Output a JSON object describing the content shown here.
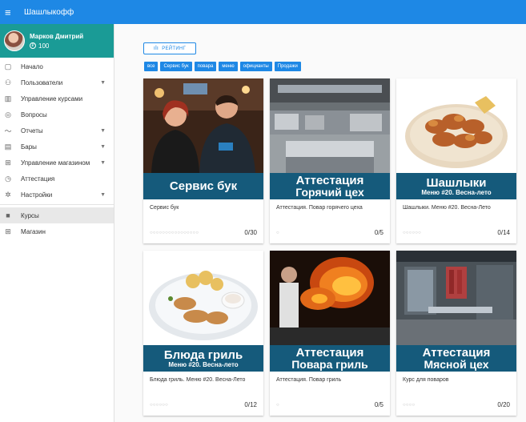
{
  "app": {
    "title": "Шашлыкофф"
  },
  "profile": {
    "name": "Марков Дмитрий",
    "points": "100"
  },
  "nav": {
    "items": [
      {
        "label": "Начало",
        "icon": "clipboard-icon",
        "glyph": "▢",
        "arrow": false
      },
      {
        "label": "Пользователи",
        "icon": "users-icon",
        "glyph": "⚇",
        "arrow": true
      },
      {
        "label": "Управление курсами",
        "icon": "library-icon",
        "glyph": "▥",
        "arrow": false
      },
      {
        "label": "Вопросы",
        "icon": "help-circle-icon",
        "glyph": "◎",
        "arrow": false
      },
      {
        "label": "Отчеты",
        "icon": "trending-icon",
        "glyph": "〜",
        "arrow": true
      },
      {
        "label": "Бары",
        "icon": "store-icon",
        "glyph": "▤",
        "arrow": true
      },
      {
        "label": "Управление магазином",
        "icon": "cart-icon",
        "glyph": "⊞",
        "arrow": true
      },
      {
        "label": "Аттестация",
        "icon": "alarm-icon",
        "glyph": "◷",
        "arrow": false
      },
      {
        "label": "Настройки",
        "icon": "gear-icon",
        "glyph": "✲",
        "arrow": true
      }
    ],
    "secondary": [
      {
        "label": "Курсы",
        "icon": "folder-icon",
        "glyph": "■",
        "active": true
      },
      {
        "label": "Магазин",
        "icon": "cart-icon",
        "glyph": "⊞",
        "active": false
      }
    ]
  },
  "main": {
    "rating_label": "РЕЙТИНГ",
    "tags": [
      "все",
      "Сервис бук",
      "повара",
      "меню",
      "официанты",
      "Продажи"
    ]
  },
  "cards": [
    {
      "banner1": "Сервис бук",
      "banner2": "",
      "title": "Сервис бук",
      "dots": "○○○○○○○○○○○○○○○○",
      "count": "0/30",
      "image": "staff-photo"
    },
    {
      "banner1": "Аттестация",
      "banner2": "Горячий цех",
      "title": "Аттестация. Повар горячего цеха",
      "dots": "○",
      "count": "0/5",
      "image": "kitchen-photo"
    },
    {
      "banner1": "Шашлыки",
      "banner2": "Меню #20. Весна-лето",
      "title": "Шашлыки. Меню #20. Весна-Лето",
      "dots": "○○○○○○",
      "count": "0/14",
      "image": "shashlik-photo"
    },
    {
      "banner1": "Блюда гриль",
      "banner2": "Меню #20. Весна-лето",
      "title": "Блюда гриль. Меню #20. Весна-Лето",
      "dots": "○○○○○○",
      "count": "0/12",
      "image": "grill-photo"
    },
    {
      "banner1": "Аттестация",
      "banner2": "Повара гриль",
      "title": "Аттестация. Повар гриль",
      "dots": "○",
      "count": "0/5",
      "image": "fire-photo"
    },
    {
      "banner1": "Аттестация",
      "banner2": "Мясной цех",
      "title": "Курс для поваров",
      "dots": "○○○○",
      "count": "0/20",
      "image": "meat-room-photo"
    }
  ],
  "colors": {
    "primary": "#1e88e5",
    "profile_bg": "#1a9b96",
    "banner": "#155a7b"
  }
}
